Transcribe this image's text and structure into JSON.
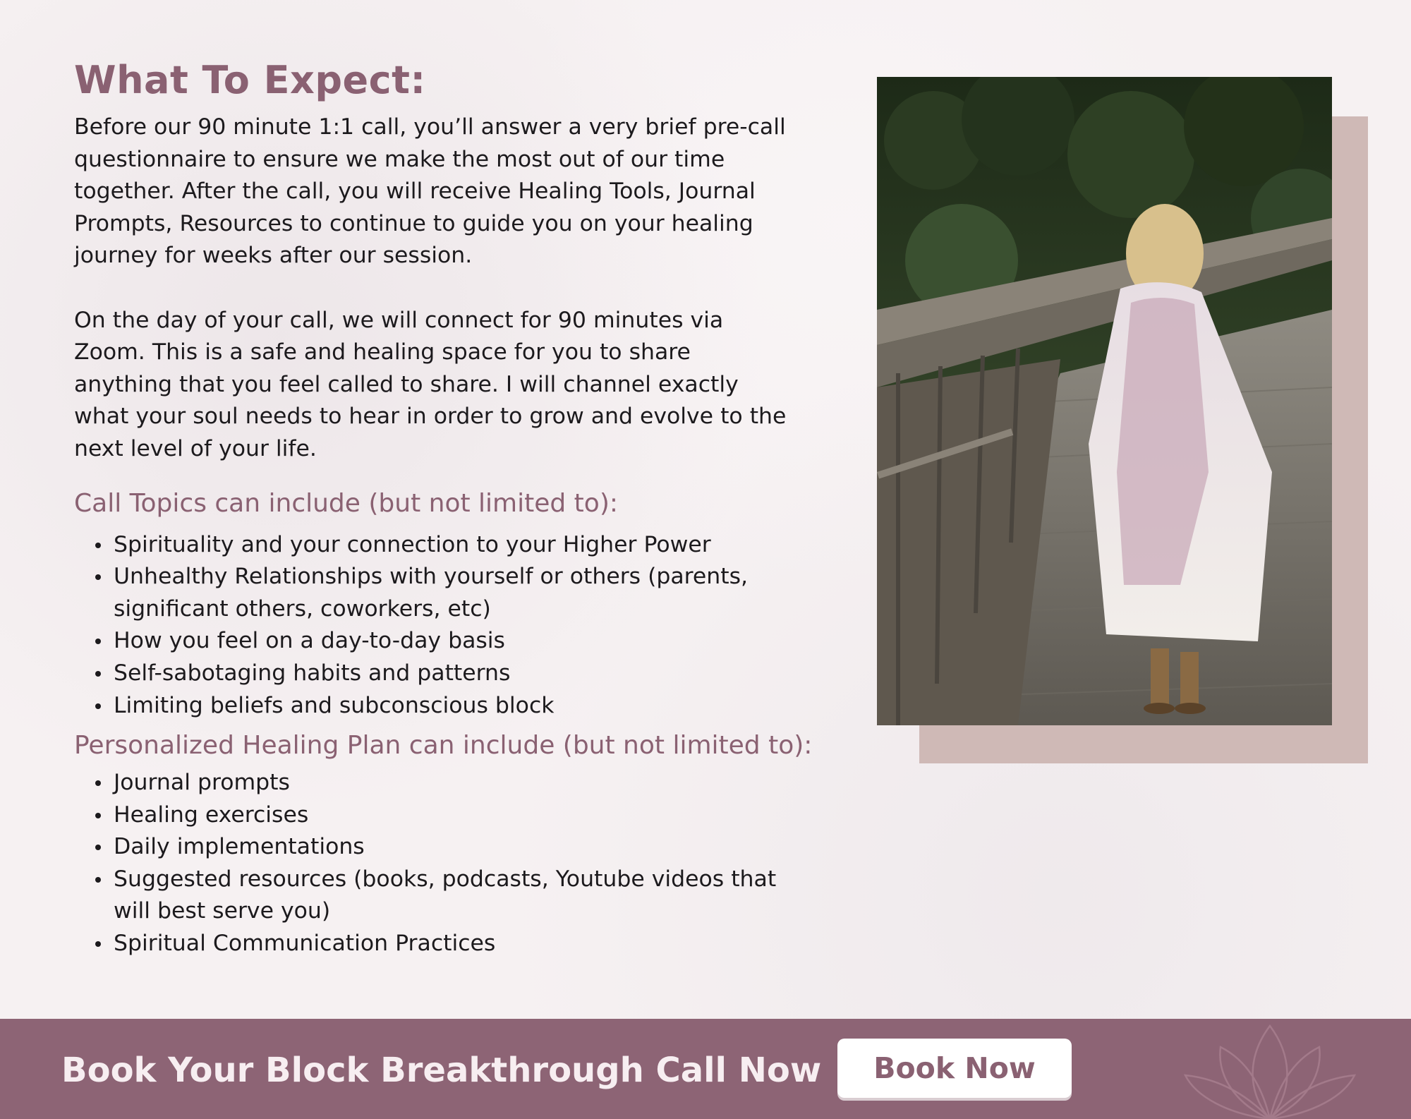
{
  "section": {
    "title": "What To Expect:",
    "paragraphs": [
      "Before our 90 minute 1:1 call, you’ll answer a very brief pre-call questionnaire to ensure we make the most out of our time together. After the call, you will receive Healing Tools, Journal Prompts, Resources to continue to guide you on your healing journey for weeks after our session.",
      "On the day of your call, we will connect for 90 minutes via Zoom. This is a safe and healing space for you to share anything that you feel called to share. I will channel exactly what your soul needs to hear in order to grow and evolve to the next level of your life."
    ],
    "topics_heading": "Call Topics can include (but not limited to):",
    "topics": [
      "Spirituality and your connection to your Higher Power",
      "Unhealthy Relationships with yourself or others (parents, significant others, coworkers, etc)",
      "How you feel on a day-to-day basis",
      "Self-sabotaging habits and patterns",
      "Limiting beliefs and subconscious block"
    ],
    "plan_heading": "Personalized Healing Plan can include (but not limited to):",
    "plan_items": [
      "Journal prompts",
      "Healing exercises",
      "Daily implementations",
      "Suggested resources (books, podcasts, Youtube videos that will best serve you)",
      "Spiritual Communication Practices"
    ]
  },
  "footer": {
    "cta_text": "Book Your Block Breakthrough Call Now",
    "button_label": "Book Now",
    "decoration_icon": "lotus-outline-icon"
  },
  "colors": {
    "accent": "#8a6172",
    "footer_bg": "#8d6475",
    "photo_shadow": "#cfb9b6",
    "background": "#f6f1f2"
  }
}
